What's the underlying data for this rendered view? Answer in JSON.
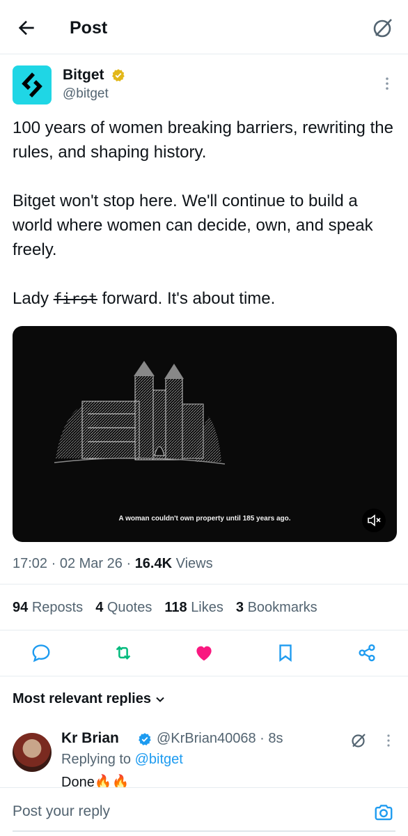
{
  "header": {
    "title": "Post",
    "back_icon": "arrow-left-icon",
    "grok_icon": "grok-icon"
  },
  "post": {
    "author": {
      "name": "Bitget",
      "handle": "@bitget",
      "verified": "gold",
      "brand_color": "#1fd6e5"
    },
    "paragraph1": "100 years of women breaking barriers, rewriting the rules, and shaping history.",
    "paragraph2": "Bitget won't stop here. We'll continue to build a world where women can decide, own, and speak freely.",
    "paragraph3_prefix": "Lady ",
    "paragraph3_strike": "first",
    "paragraph3_suffix": " forward. It's about time.",
    "media": {
      "caption": "A woman couldn't own property until 185 years ago.",
      "mute_icon": "volume-muted-icon"
    },
    "time": "17:02",
    "date": "02 Mar 26",
    "views_count": "16.4K",
    "views_label": "Views",
    "stats": [
      {
        "count": "94",
        "label": "Reposts"
      },
      {
        "count": "4",
        "label": "Quotes"
      },
      {
        "count": "118",
        "label": "Likes"
      },
      {
        "count": "3",
        "label": "Bookmarks"
      }
    ],
    "liked": true
  },
  "replies_header": "Most relevant replies",
  "reply": {
    "name": "Kr Brian",
    "handle": "@KrBrian40068 · 8s",
    "replying_prefix": "Replying to ",
    "replying_to": "@bitget",
    "text": "Done🔥🔥"
  },
  "composer": {
    "placeholder": "Post your reply"
  },
  "colors": {
    "accent": "#1d9bf0",
    "like": "#f91880",
    "repost": "#00ba7c",
    "text": "#0f1419",
    "muted": "#536471",
    "gold": "#e2b719"
  }
}
